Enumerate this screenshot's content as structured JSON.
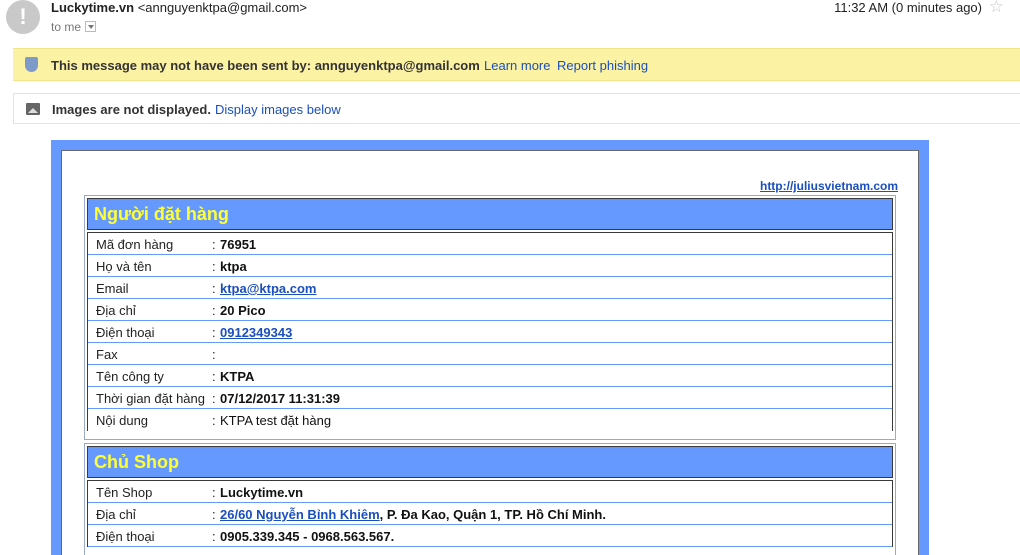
{
  "header": {
    "avatar_glyph": "!",
    "sender_name": "Luckytime.vn",
    "sender_email": "<annguyenktpa@gmail.com>",
    "to_label": "to me",
    "time": "11:32 AM (0 minutes ago)",
    "star_glyph": "☆"
  },
  "warning": {
    "text": "This message may not have been sent by: annguyenktpa@gmail.com",
    "learn_more": "Learn more",
    "report_phishing": "Report phishing"
  },
  "images_bar": {
    "text": "Images are not displayed.",
    "link": "Display images below"
  },
  "email": {
    "site_link": "http://juliusvietnam.com",
    "buyer": {
      "title": "Người đặt hàng",
      "rows": [
        {
          "label": "Mã đơn hàng",
          "colon": ":",
          "value": "76951"
        },
        {
          "label": "Họ và tên",
          "colon": ":",
          "value": "ktpa"
        },
        {
          "label": "Email",
          "colon": ":",
          "value": "ktpa@ktpa.com"
        },
        {
          "label": "Địa chỉ",
          "colon": ":",
          "value": "20 Pico"
        },
        {
          "label": "Điện thoại",
          "colon": ":",
          "value": "0912349343"
        },
        {
          "label": "Fax",
          "colon": ":",
          "value": ""
        },
        {
          "label": "Tên công ty",
          "colon": ":",
          "value": "KTPA"
        },
        {
          "label": "Thời gian đặt hàng",
          "colon": ":",
          "value": "07/12/2017 11:31:39"
        },
        {
          "label": "Nội dung",
          "colon": ":",
          "value": "KTPA test đặt hàng"
        }
      ]
    },
    "shop": {
      "title": "Chủ Shop",
      "rows": [
        {
          "label": "Tên Shop",
          "colon": ":",
          "value": "Luckytime.vn"
        },
        {
          "label": "Địa chỉ",
          "colon": ":",
          "value_link": "26/60 Nguyễn Bỉnh Khiêm",
          "value_rest": ", P. Đa Kao, Quận 1, TP. Hồ Chí Minh."
        },
        {
          "label": "Điện thoại",
          "colon": ":",
          "value": "0905.339.345 - 0968.563.567."
        }
      ]
    }
  },
  "colors": {
    "accent": "#6699ff",
    "title_text": "#ffff33",
    "warning_bg": "#fcf2a4",
    "link": "#1a4fbf"
  }
}
